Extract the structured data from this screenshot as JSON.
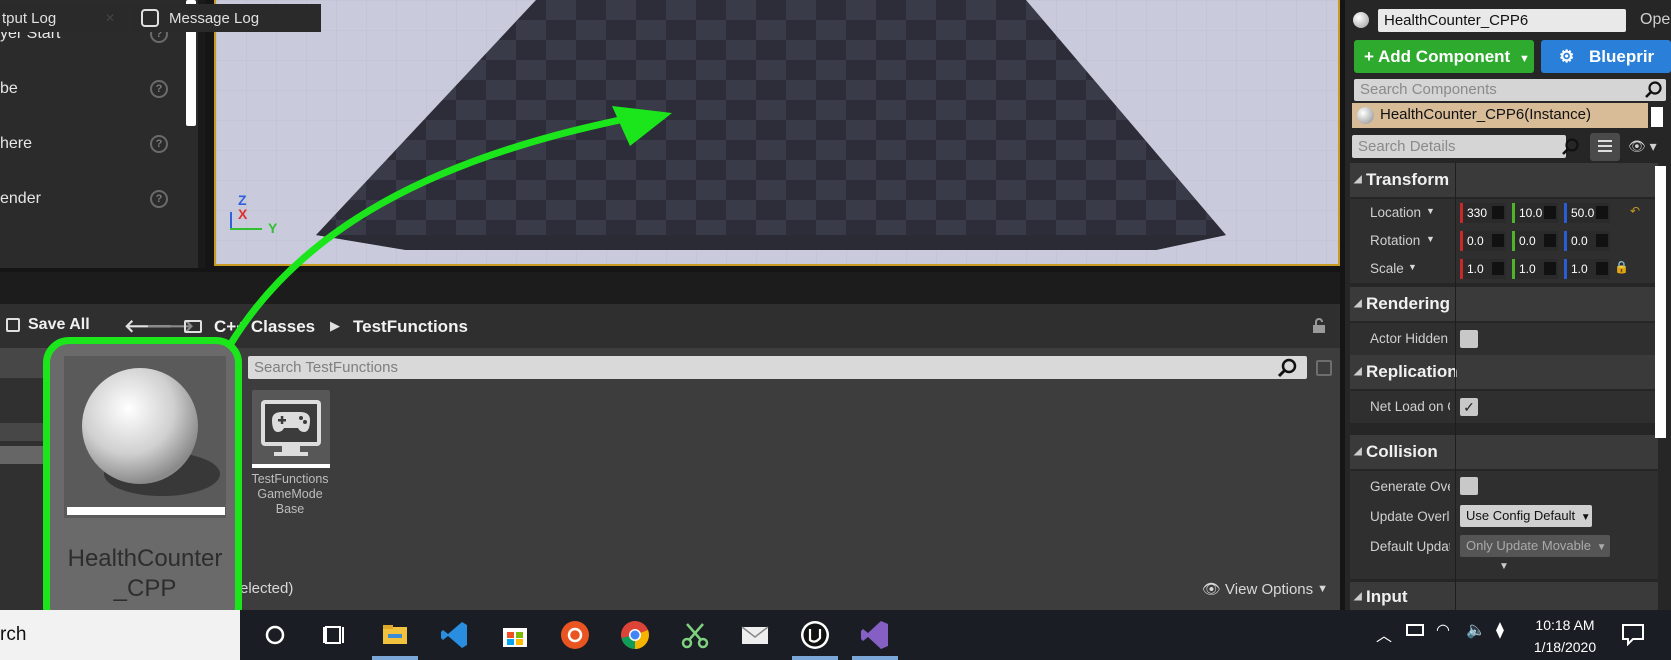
{
  "place_actors": {
    "items": [
      {
        "label": "yer Start"
      },
      {
        "label": "be"
      },
      {
        "label": "here"
      },
      {
        "label": "ender"
      }
    ],
    "help_glyph": "?"
  },
  "viewport": {
    "axis": {
      "z": "Z",
      "x": "X",
      "y": "Y"
    }
  },
  "tabs": {
    "output_log": "tput Log",
    "message_log": "Message Log"
  },
  "content_browser": {
    "save_all": "Save All",
    "breadcrumb": [
      "C++ Classes",
      "TestFunctions"
    ],
    "search_placeholder": "Search TestFunctions",
    "assets": [
      {
        "name": "TestFunctions\nGameMode\nBase",
        "line1": "TestFunctions",
        "line2": "GameMode",
        "line3": "Base"
      }
    ],
    "dragged_asset": {
      "line1": "HealthCounter",
      "line2": "_CPP"
    },
    "selection_status": "elected)",
    "view_options": "View Options"
  },
  "details": {
    "actor_name": "HealthCounter_CPP6",
    "open_link": "Ope",
    "add_component": "+ Add Component",
    "blueprint_btn": "Blueprir",
    "search_components_placeholder": "Search Components",
    "component_instance": "HealthCounter_CPP6(Instance)",
    "search_details_placeholder": "Search Details",
    "sections": {
      "transform": "Transform",
      "rendering": "Rendering",
      "replication": "Replication",
      "collision": "Collision",
      "input": "Input"
    },
    "transform": {
      "location": {
        "label": "Location",
        "values": [
          "330",
          "10.0",
          "50.0"
        ]
      },
      "rotation": {
        "label": "Rotation",
        "values": [
          "0.0",
          "0.0",
          "0.0"
        ]
      },
      "scale": {
        "label": "Scale",
        "values": [
          "1.0",
          "1.0",
          "1.0"
        ]
      }
    },
    "rendering": {
      "actor_hidden_label": "Actor Hidden In",
      "actor_hidden_checked": false
    },
    "replication": {
      "net_load_label": "Net Load on Cli",
      "net_load_checked": true
    },
    "collision": {
      "generate_overlap_label": "Generate Over",
      "generate_overlap_checked": false,
      "update_overlap_label": "Update Overlap",
      "update_overlap_value": "Use Config Default",
      "default_update_label": "Default Update",
      "default_update_value": "Only Update Movable"
    }
  },
  "taskbar": {
    "search_text": "rch",
    "time": "10:18 AM",
    "date": "1/18/2020"
  },
  "colors": {
    "highlight_green": "#1be61b",
    "add_component_green": "#2eaa2e",
    "blueprint_blue": "#2a7fd8",
    "viewport_border": "#c79a20",
    "axis_x": "#e03030",
    "axis_y": "#30c030",
    "axis_z": "#3060e0"
  }
}
